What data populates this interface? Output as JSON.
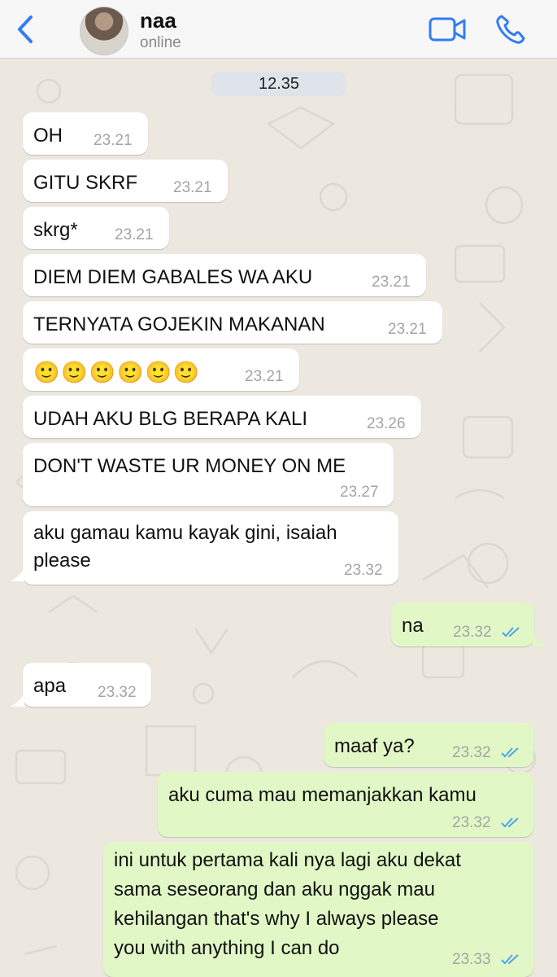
{
  "header": {
    "contact_name": "naa",
    "contact_status": "online",
    "icons": {
      "back": "chevron-left-icon",
      "video": "video-call-icon",
      "voice": "phone-icon"
    },
    "accent_color": "#2f7cf6"
  },
  "chat": {
    "date_label": "12.35",
    "messages": [
      {
        "dir": "in",
        "text": "OH",
        "time": "23.21"
      },
      {
        "dir": "in",
        "text": "GITU SKRF",
        "time": "23.21"
      },
      {
        "dir": "in",
        "text": "skrg*",
        "time": "23.21"
      },
      {
        "dir": "in",
        "text": "DIEM DIEM GABALES WA AKU",
        "time": "23.21"
      },
      {
        "dir": "in",
        "text": "TERNYATA GOJEKIN MAKANAN",
        "time": "23.21"
      },
      {
        "dir": "in",
        "text": "🙂🙂🙂🙂🙂🙂",
        "time": "23.21"
      },
      {
        "dir": "in",
        "text": "UDAH AKU BLG BERAPA KALI",
        "time": "23.26"
      },
      {
        "dir": "in",
        "text": "DON'T WASTE UR MONEY ON ME",
        "time": "23.27"
      },
      {
        "dir": "in",
        "lines": [
          "aku gamau kamu kayak gini, isaiah",
          "please"
        ],
        "time": "23.32"
      },
      {
        "dir": "out",
        "text": "na",
        "time": "23.32",
        "status": "read"
      },
      {
        "dir": "in",
        "text": "apa",
        "time": "23.32"
      },
      {
        "dir": "out",
        "text": "maaf ya?",
        "time": "23.32",
        "status": "read"
      },
      {
        "dir": "out",
        "text": "aku cuma mau memanjakkan kamu",
        "time": "23.32",
        "status": "read"
      },
      {
        "dir": "out",
        "lines": [
          "ini untuk pertama kali nya lagi aku dekat",
          "sama seseorang dan aku nggak mau",
          "kehilangan that's why I always please",
          "you with anything I can do"
        ],
        "time": "23.33",
        "status": "read"
      }
    ]
  },
  "colors": {
    "incoming_bubble": "#ffffff",
    "outgoing_bubble": "#e1f8c6",
    "read_ticks": "#4fa3e8",
    "chat_background": "#ece8df"
  }
}
